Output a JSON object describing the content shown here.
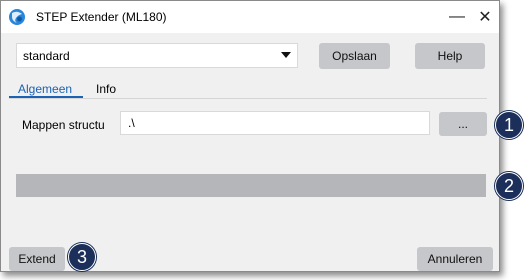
{
  "window": {
    "title": "STEP Extender (ML180)",
    "minimize_glyph": "—",
    "close_glyph": "✕"
  },
  "toolbar": {
    "profile_select_value": "standard",
    "save_label": "Opslaan",
    "help_label": "Help"
  },
  "tabs": [
    {
      "label": "Algemeen",
      "active": true
    },
    {
      "label": "Info",
      "active": false
    }
  ],
  "general": {
    "folder_structure_label": "Mappen structu",
    "folder_structure_value": ".\\",
    "browse_label": "..."
  },
  "progress": {
    "value": 0
  },
  "footer": {
    "extend_label": "Extend",
    "cancel_label": "Annuleren"
  },
  "callouts": [
    "1",
    "2",
    "3"
  ],
  "colors": {
    "accent": "#1b62b3",
    "button": "#c6c7cb",
    "progress_track": "#b5b6ba",
    "callout": "#1b2f5a"
  },
  "icons": {
    "app": "step-extender-app-icon",
    "dropdown": "chevron-down-icon"
  }
}
